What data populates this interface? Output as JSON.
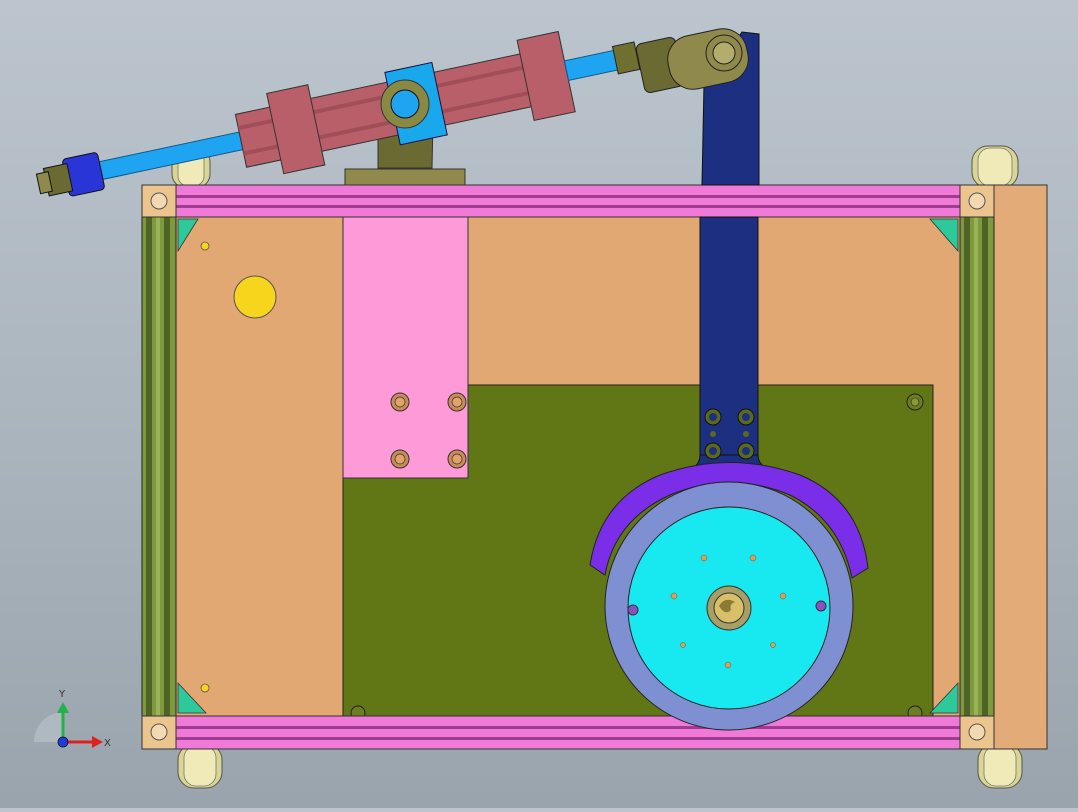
{
  "title": "",
  "triad": {
    "x_label": "X",
    "y_label": "Y"
  },
  "colors": {
    "background": "#b0bac3",
    "frame_rail": "#f07ad8",
    "frame_rail_stripe": "#a03c90",
    "base_plate": "#e2a873",
    "mount_plate": "#6a7a16",
    "bracket_plate": "#ff9ad8",
    "lever_arm": "#1d2f80",
    "cylinder_barrel": "#b85f69",
    "piston_rod": "#1ea4f0",
    "rod_end": "#2a35d8",
    "clevis": "#6a6a32",
    "wheel": "#dcd898",
    "disc": "#18e8f0",
    "disc_ring": "#7f90d2",
    "guard_arc": "#7b2ee8",
    "corner_bracket": "#2ec99a",
    "side_panel": "#e3ab77"
  },
  "assembly": {
    "parts": [
      "pneumatic-cylinder",
      "piston-rod",
      "rod-end-clevis",
      "lever-arm",
      "rotary-disc",
      "guard-arc",
      "aluminum-profile-frame",
      "base-plate",
      "mount-plate",
      "bracket-plate",
      "caster-wheels"
    ]
  }
}
